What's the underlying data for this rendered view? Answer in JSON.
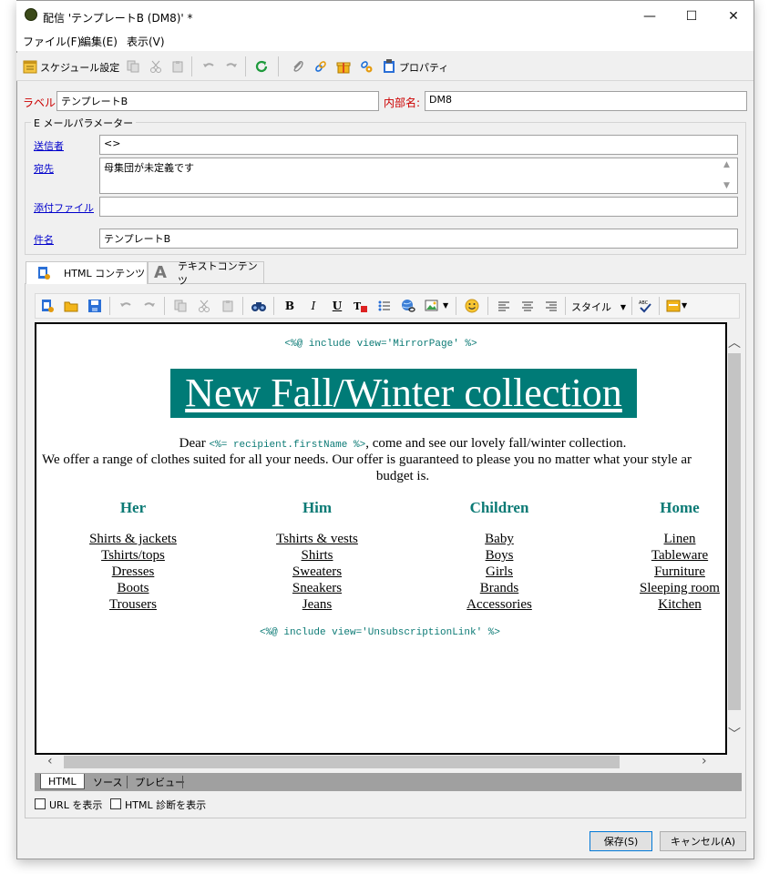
{
  "window": {
    "title": "配信 'テンプレートB (DM8)' *",
    "minimize": "—",
    "maximize": "☐",
    "close": "✕"
  },
  "menu": [
    "ファイル(F)",
    "編集(E)",
    "表示(V)"
  ],
  "toolbar": {
    "schedule_label": "スケジュール設定",
    "properties_label": "プロパティ"
  },
  "form": {
    "label_label": "ラベル:",
    "label_value": "テンプレートB",
    "internal_name_label": "内部名:",
    "internal_name_value": "DM8",
    "group_title": "E メールパラメーター",
    "sender_label": "送信者",
    "sender_value": "<>",
    "recipient_label": "宛先",
    "recipient_value": "母集団が未定義です",
    "attachment_label": "添付ファイル",
    "attachment_value": "",
    "subject_label": "件名",
    "subject_value": "テンプレートB"
  },
  "tabs": {
    "html_content": "HTML コンテンツ",
    "text_content": "テキストコンテンツ"
  },
  "editor_toolbar": {
    "style_label": "スタイル"
  },
  "editor": {
    "mirror_include": "<%@ include view='MirrorPage' %>",
    "headline": "New Fall/Winter collection",
    "dear": "Dear",
    "first_name_tag": "<%= recipient.firstName %>",
    "intro_rest": ", come and see our lovely fall/winter collection.",
    "line2a": "We offer a range of clothes suited for all your needs. Our offer is guaranteed to please you no matter what your style ar",
    "line2b": "budget is.",
    "columns": [
      {
        "title": "Her",
        "links": [
          "Shirts & jackets",
          "Tshirts/tops",
          "Dresses",
          "Boots",
          "Trousers"
        ]
      },
      {
        "title": "Him",
        "links": [
          "Tshirts & vests",
          "Shirts",
          "Sweaters",
          "Sneakers",
          "Jeans"
        ]
      },
      {
        "title": "Children",
        "links": [
          "Baby",
          "Boys",
          "Girls",
          "Brands",
          "Accessories"
        ]
      },
      {
        "title": "Home",
        "links": [
          "Linen",
          "Tableware",
          "Furniture",
          "Sleeping room",
          "Kitchen"
        ]
      }
    ],
    "unsub_include": "<%@ include view='UnsubscriptionLink' %>"
  },
  "view_tabs": [
    "HTML",
    "ソース",
    "プレビュー"
  ],
  "options": {
    "show_url": "URL を表示",
    "show_html_diag": "HTML 診断を表示"
  },
  "buttons": {
    "save": "保存(S)",
    "cancel": "キャンセル(A)"
  },
  "colors": {
    "headline_bg": "#007b77",
    "teal_text": "#0b7a75",
    "label_red": "#cc0000",
    "link_blue": "#0000cc"
  }
}
